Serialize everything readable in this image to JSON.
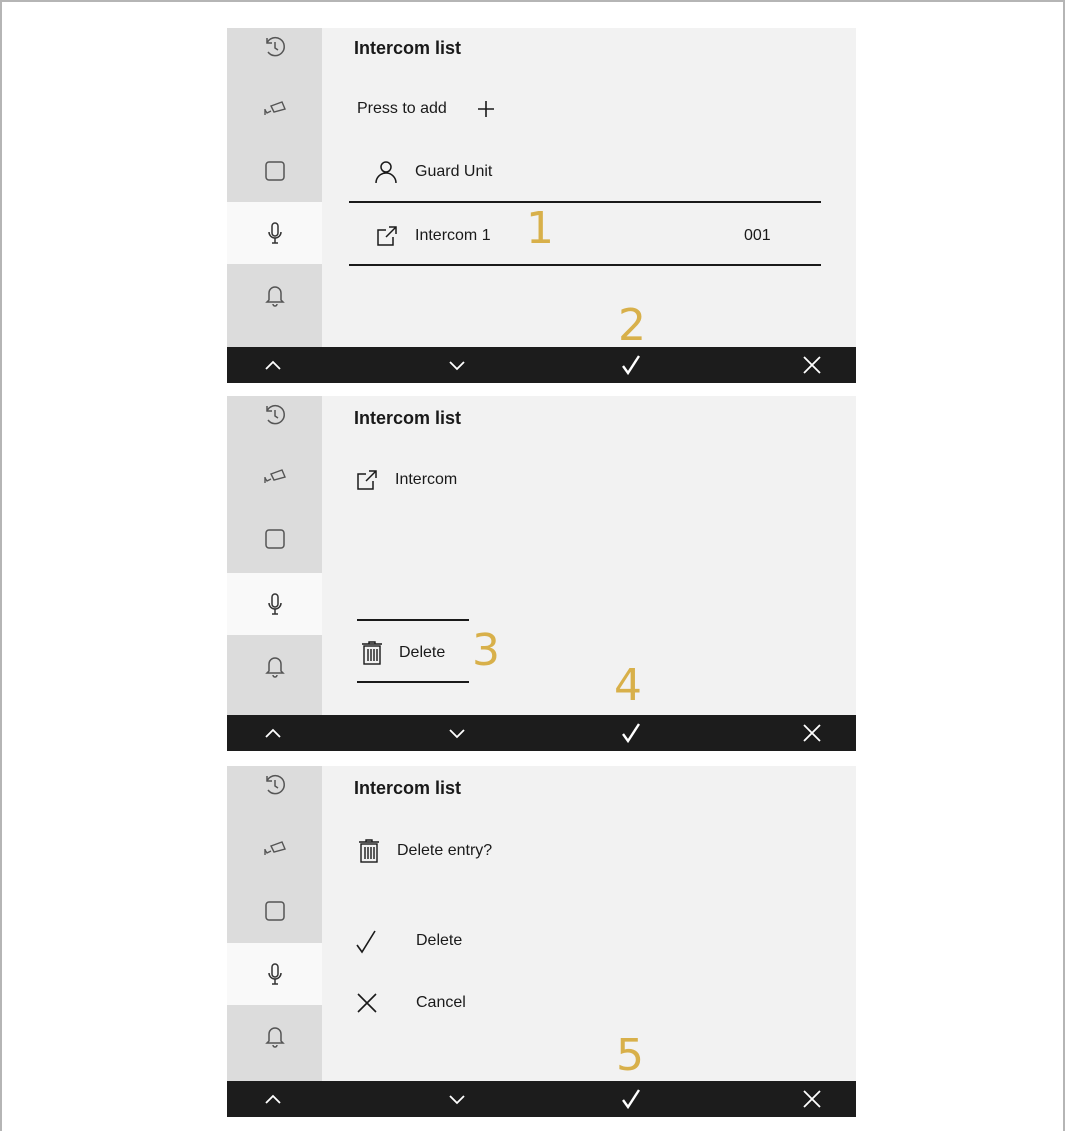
{
  "screens": [
    {
      "title": "Intercom list",
      "press_to_add": "Press to add",
      "guard_unit": "Guard Unit",
      "intercom_name": "Intercom 1",
      "intercom_number": "001",
      "step_labels": [
        "1",
        "2"
      ]
    },
    {
      "title": "Intercom list",
      "intercom_label": "Intercom",
      "delete_label": "Delete",
      "step_labels": [
        "3",
        "4"
      ]
    },
    {
      "title": "Intercom list",
      "prompt": "Delete entry?",
      "confirm_label": "Delete",
      "cancel_label": "Cancel",
      "step_labels": [
        "5"
      ]
    }
  ],
  "sidebar": {
    "icons": [
      "history-icon",
      "camera-icon",
      "square-icon",
      "microphone-icon",
      "bell-icon"
    ],
    "active_index": 3
  },
  "bottombar": {
    "icons": [
      "chevron-up-icon",
      "chevron-down-icon",
      "check-icon",
      "close-icon"
    ]
  },
  "colors": {
    "screen_bg": "#f2f2f2",
    "sidebar_bg": "#dcdcdc",
    "sidebar_active_bg": "#f9f9f9",
    "bar_bg": "#1c1c1c",
    "step_label": "#d8b04a"
  }
}
